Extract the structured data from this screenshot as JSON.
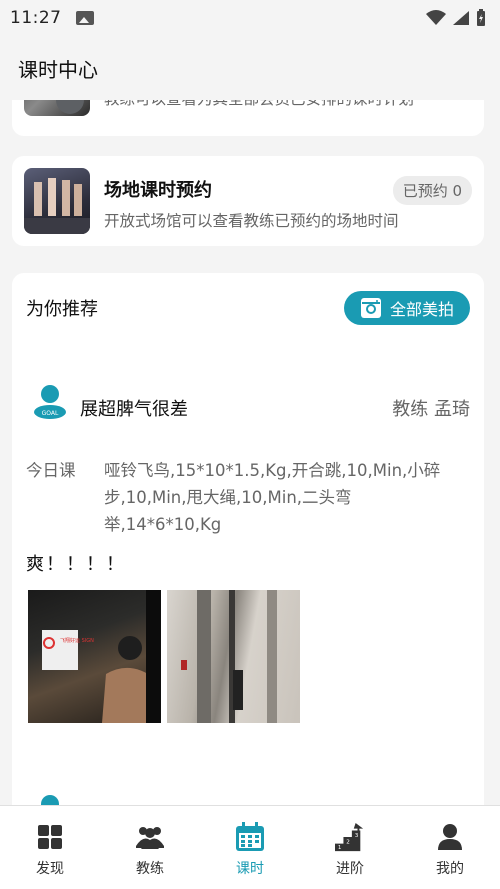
{
  "status": {
    "time": "11:27"
  },
  "header": {
    "title": "课时中心"
  },
  "cards": [
    {
      "title": "",
      "desc": "教练可以查看为其全部会员已安排的课时计划"
    },
    {
      "title": "场地课时预约",
      "desc": "开放式场馆可以查看教练已预约的场地时间",
      "badge": "已预约 0"
    }
  ],
  "recommend": {
    "title": "为你推荐",
    "all_label": "全部美拍",
    "post": {
      "user": "展超脾气很差",
      "coach": "教练 孟琦",
      "today_label": "今日课",
      "today_text": "哑铃飞鸟,15*10*1.5,Kg,开合跳,10,Min,小碎步,10,Min,甩大绳,10,Min,二头弯举,14*6*10,Kg",
      "text": "爽！！！！",
      "photo1_sign": "飞翔好运 SIGN"
    }
  },
  "tabs": [
    {
      "label": "发现",
      "icon": "grid-icon"
    },
    {
      "label": "教练",
      "icon": "group-icon"
    },
    {
      "label": "课时",
      "icon": "calendar-icon",
      "active": true
    },
    {
      "label": "进阶",
      "icon": "stairs-icon"
    },
    {
      "label": "我的",
      "icon": "person-icon"
    }
  ],
  "colors": {
    "accent": "#1a9bb3",
    "background": "#f4f4f4"
  }
}
